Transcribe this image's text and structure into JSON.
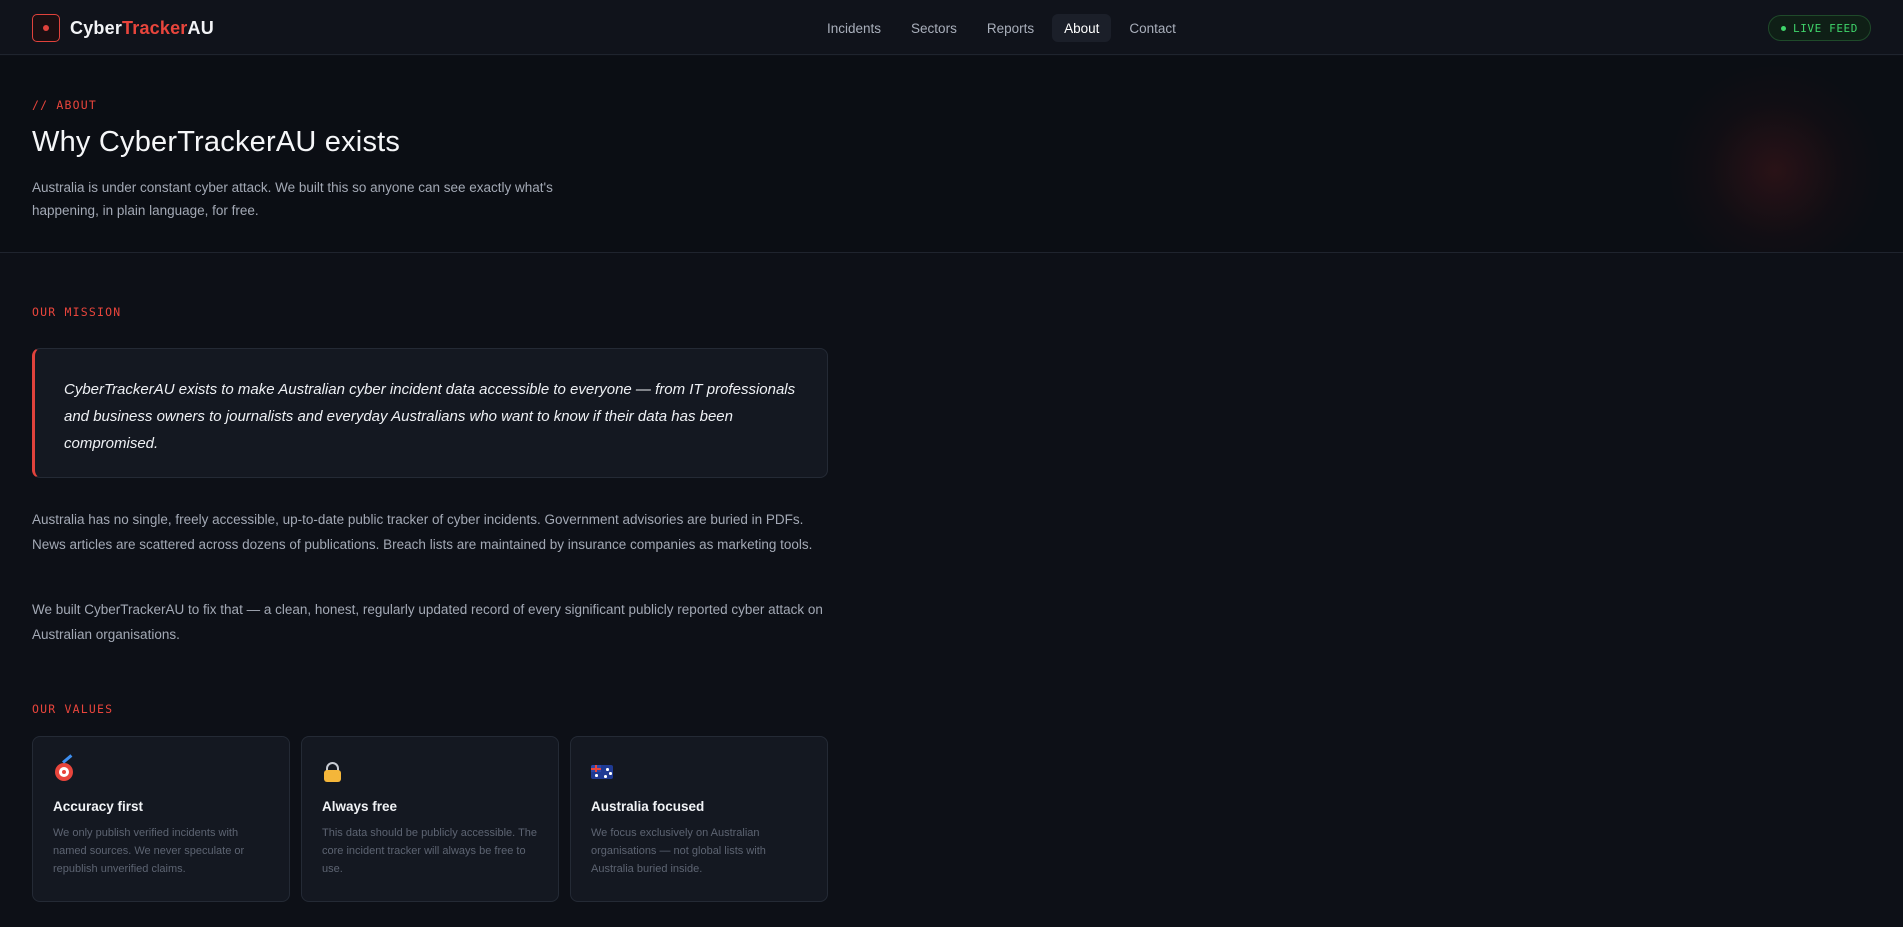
{
  "brand": {
    "part_a": "Cyber",
    "part_b": "Tracker",
    "part_c": "AU"
  },
  "nav": {
    "links": [
      "Incidents",
      "Sectors",
      "Reports",
      "About",
      "Contact"
    ],
    "active": "About",
    "live_label": "LIVE FEED"
  },
  "hero": {
    "eyebrow": "// ABOUT",
    "title": "Why CyberTrackerAU exists",
    "subtitle": "Australia is under constant cyber attack. We built this so anyone can see exactly what's happening, in plain language, for free."
  },
  "mission": {
    "label": "OUR MISSION",
    "quote": "CyberTrackerAU exists to make Australian cyber incident data accessible to everyone — from IT professionals and business owners to journalists and everyday Australians who want to know if their data has been compromised.",
    "paragraphs": [
      "Australia has no single, freely accessible, up-to-date public tracker of cyber incidents. Government advisories are buried in PDFs. News articles are scattered across dozens of publications. Breach lists are maintained by insurance companies as marketing tools.",
      "We built CyberTrackerAU to fix that — a clean, honest, regularly updated record of every significant publicly reported cyber attack on Australian organisations."
    ]
  },
  "values": {
    "label": "OUR VALUES",
    "cards": [
      {
        "icon": "target-icon",
        "title": "Accuracy first",
        "desc": "We only publish verified incidents with named sources. We never speculate or republish unverified claims."
      },
      {
        "icon": "lock-icon",
        "title": "Always free",
        "desc": "This data should be publicly accessible. The core incident tracker will always be free to use."
      },
      {
        "icon": "australia-flag-icon",
        "title": "Australia focused",
        "desc": "We focus exclusively on Australian organisations — not global lists with Australia buried inside."
      }
    ]
  },
  "colors": {
    "accent": "#e8453c",
    "live": "#3fd46a",
    "background": "#0d1017"
  }
}
